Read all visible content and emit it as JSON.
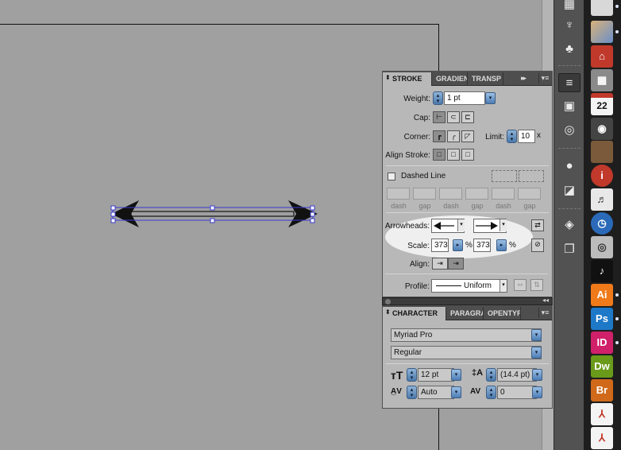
{
  "stroke_panel": {
    "tabs": [
      "STROKE",
      "GRADIEN",
      "TRANSP"
    ],
    "tab_scroll_label": "▸▸",
    "weight": {
      "label": "Weight:",
      "value": "1 pt"
    },
    "cap_label": "Cap:",
    "corner_label": "Corner:",
    "limit": {
      "label": "Limit:",
      "value": "10",
      "unit": "x"
    },
    "align_stroke_label": "Align Stroke:",
    "dashed_line": {
      "label": "Dashed Line",
      "checked": false
    },
    "dash_gap_labels": [
      "dash",
      "gap",
      "dash",
      "gap",
      "dash",
      "gap"
    ],
    "arrowheads_label": "Arrowheads:",
    "scale": {
      "label": "Scale:",
      "start": "373",
      "end": "373",
      "unit": "%"
    },
    "align_label": "Align:",
    "profile": {
      "label": "Profile:",
      "value": "Uniform"
    }
  },
  "character_panel": {
    "tabs": [
      "CHARACTER",
      "PARAGRA",
      "OPENTYP"
    ],
    "font_family": "Myriad Pro",
    "font_style": "Regular",
    "font_size": "12 pt",
    "leading": "(14.4 pt)",
    "kerning": "Auto",
    "tracking": "0"
  },
  "dock": [
    {
      "icon": "ai-icon",
      "label": "Ai",
      "color": "#f07a1a"
    },
    {
      "icon": "ps-icon",
      "label": "Ps",
      "color": "#1e78c8"
    },
    {
      "icon": "id-icon",
      "label": "ID",
      "color": "#d0206a"
    },
    {
      "icon": "dw-icon",
      "label": "Dw",
      "color": "#6a9a1a"
    },
    {
      "icon": "br-icon",
      "label": "Br",
      "color": "#d06a1a"
    }
  ],
  "dock_calendar_day": "22",
  "colors": {
    "panel_bg": "#b8b8b8",
    "tab_bar": "#4e4e4e",
    "selection": "#3a3ad0"
  }
}
